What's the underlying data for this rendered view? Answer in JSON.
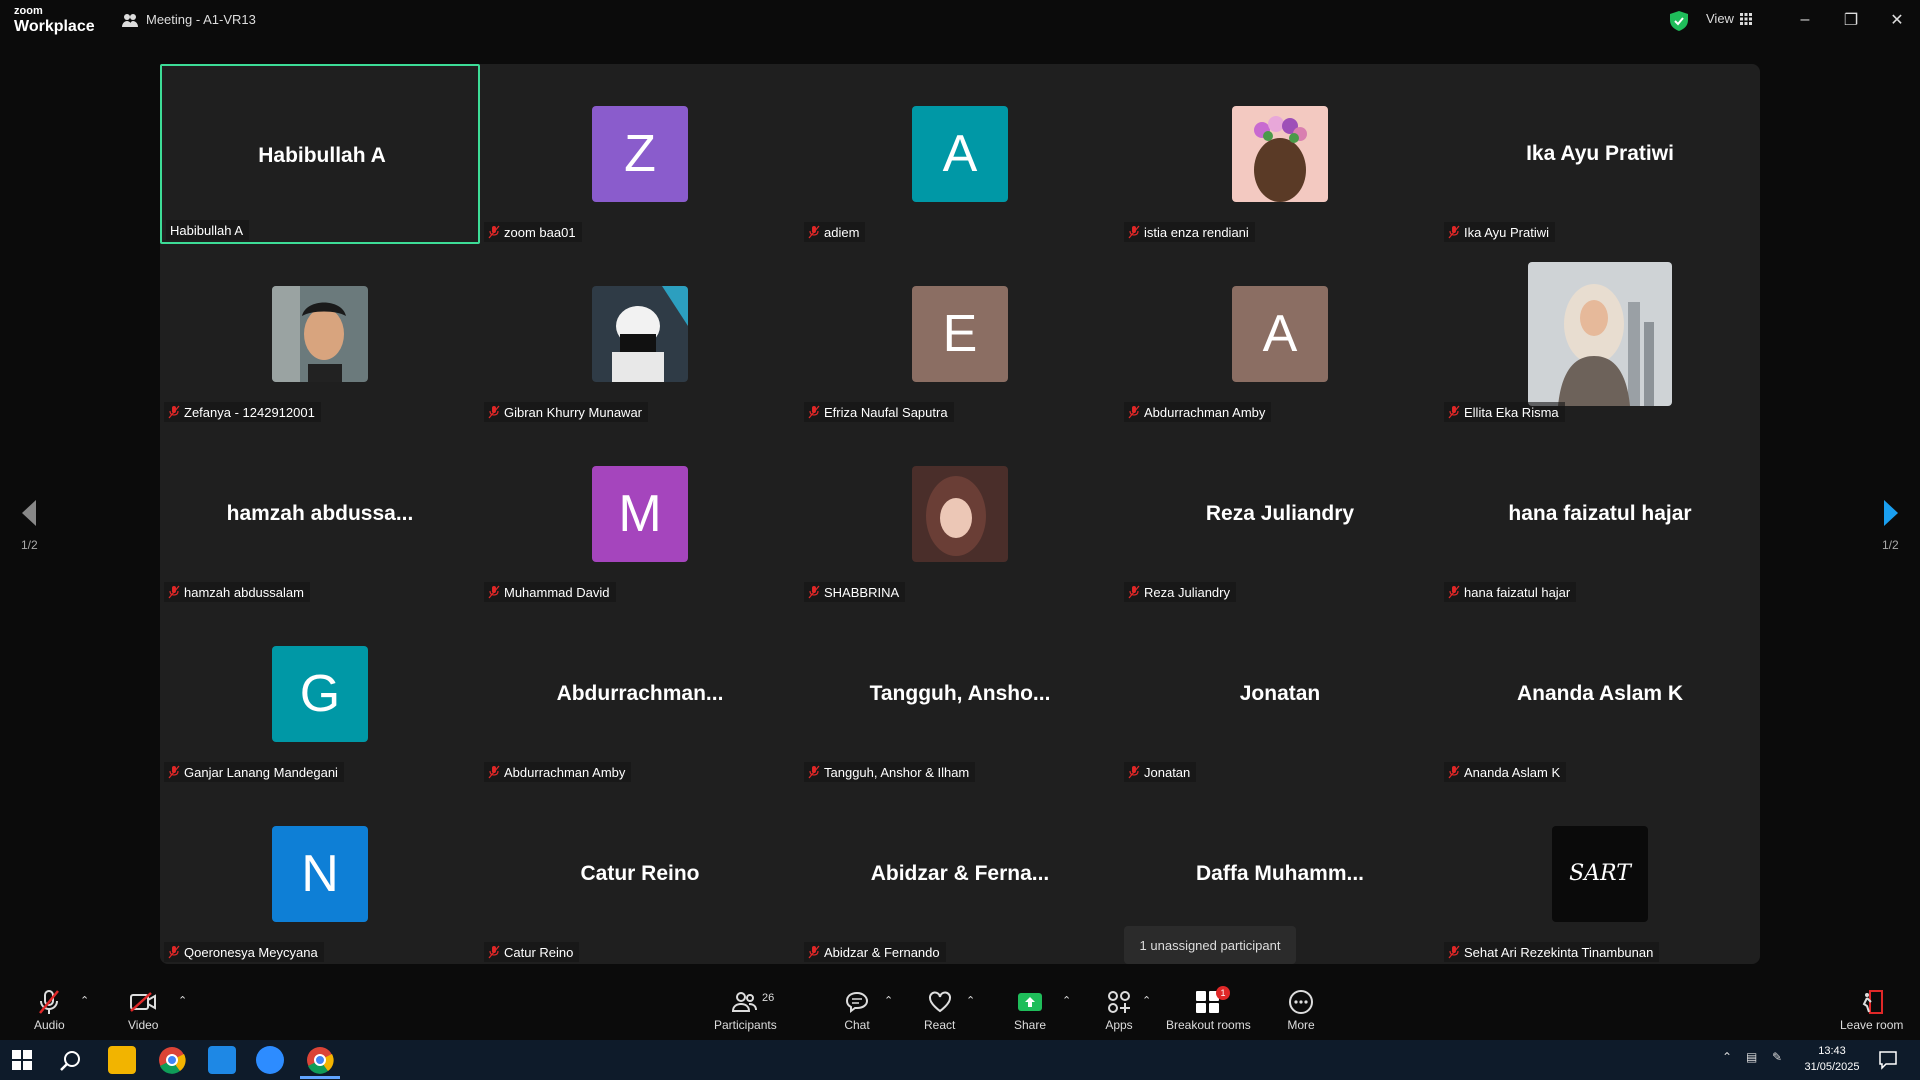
{
  "app": {
    "brand_top": "zoom",
    "brand_bottom": "Workplace",
    "meeting_title": "Meeting - A1-VR13",
    "view_label": "View"
  },
  "gallery": {
    "page_left": "1/2",
    "page_right": "1/2",
    "tiles": [
      {
        "name": "Habibullah A",
        "big": "Habibullah A",
        "type": "name",
        "active": true,
        "muted": false
      },
      {
        "name": "zoom baa01",
        "letter": "Z",
        "color": "#8a5ccc",
        "type": "letter",
        "muted": true
      },
      {
        "name": "adiem",
        "letter": "A",
        "color": "#0098a6",
        "type": "letter",
        "muted": true
      },
      {
        "name": "istia enza rendiani",
        "type": "photo",
        "photo": "flowers",
        "muted": true
      },
      {
        "name": "Ika Ayu Pratiwi",
        "big": "Ika Ayu Pratiwi",
        "type": "name",
        "muted": true
      },
      {
        "name": "Zefanya - 1242912001",
        "type": "photo",
        "photo": "man",
        "muted": true
      },
      {
        "name": "Gibran Khurry Munawar",
        "type": "photo",
        "photo": "anime",
        "muted": true
      },
      {
        "name": "Efriza Naufal Saputra",
        "letter": "E",
        "color": "#8b6e63",
        "type": "letter",
        "muted": true
      },
      {
        "name": "Abdurrachman Amby",
        "letter": "A",
        "color": "#8b6e63",
        "type": "letter",
        "muted": true
      },
      {
        "name": "Ellita Eka Risma",
        "type": "photo",
        "photo": "hijab",
        "muted": true
      },
      {
        "name": "hamzah abdussalam",
        "big": "hamzah abdussa...",
        "type": "name",
        "muted": true
      },
      {
        "name": "Muhammad David",
        "letter": "M",
        "color": "#a545bd",
        "type": "letter",
        "muted": true
      },
      {
        "name": "SHABBRINA",
        "type": "photo",
        "photo": "woman",
        "muted": true
      },
      {
        "name": "Reza Juliandry",
        "big": "Reza Juliandry",
        "type": "name",
        "muted": true
      },
      {
        "name": "hana faizatul hajar",
        "big": "hana faizatul hajar",
        "type": "name",
        "muted": true
      },
      {
        "name": "Ganjar Lanang Mandegani",
        "letter": "G",
        "color": "#0098a6",
        "type": "letter",
        "muted": true
      },
      {
        "name": "Abdurrachman Amby",
        "big": "Abdurrachman...",
        "type": "name",
        "muted": true
      },
      {
        "name": "Tangguh, Anshor & Ilham",
        "big": "Tangguh,  Ansho...",
        "type": "name",
        "muted": true
      },
      {
        "name": "Jonatan",
        "big": "Jonatan",
        "type": "name",
        "muted": true
      },
      {
        "name": "Ananda Aslam K",
        "big": "Ananda Aslam K",
        "type": "name",
        "muted": true
      },
      {
        "name": "Qoeronesya Meycyana",
        "letter": "N",
        "color": "#0e7fd6",
        "type": "letter",
        "muted": true
      },
      {
        "name": "Catur Reino",
        "big": "Catur Reino",
        "type": "name",
        "muted": true
      },
      {
        "name": "Abidzar & Fernando",
        "big": "Abidzar & Ferna...",
        "type": "name",
        "muted": true
      },
      {
        "name": "",
        "big": "Daffa  Muhamm...",
        "type": "name",
        "muted": true
      },
      {
        "name": "Sehat Ari Rezekinta Tinambunan",
        "type": "photo",
        "photo": "sart",
        "muted": true
      }
    ]
  },
  "tooltip": "1 unassigned participant",
  "toolbar": {
    "audio": "Audio",
    "video": "Video",
    "participants": "Participants",
    "participants_count": "26",
    "chat": "Chat",
    "react": "React",
    "share": "Share",
    "apps": "Apps",
    "breakout": "Breakout rooms",
    "breakout_badge": "1",
    "more": "More",
    "leave": "Leave room"
  },
  "taskbar": {
    "time": "13:43",
    "date": "31/05/2025"
  },
  "colors": {
    "active_border": "#3ddc97",
    "share_green": "#1fbd5a",
    "arrow_blue": "#1a9ff0"
  }
}
